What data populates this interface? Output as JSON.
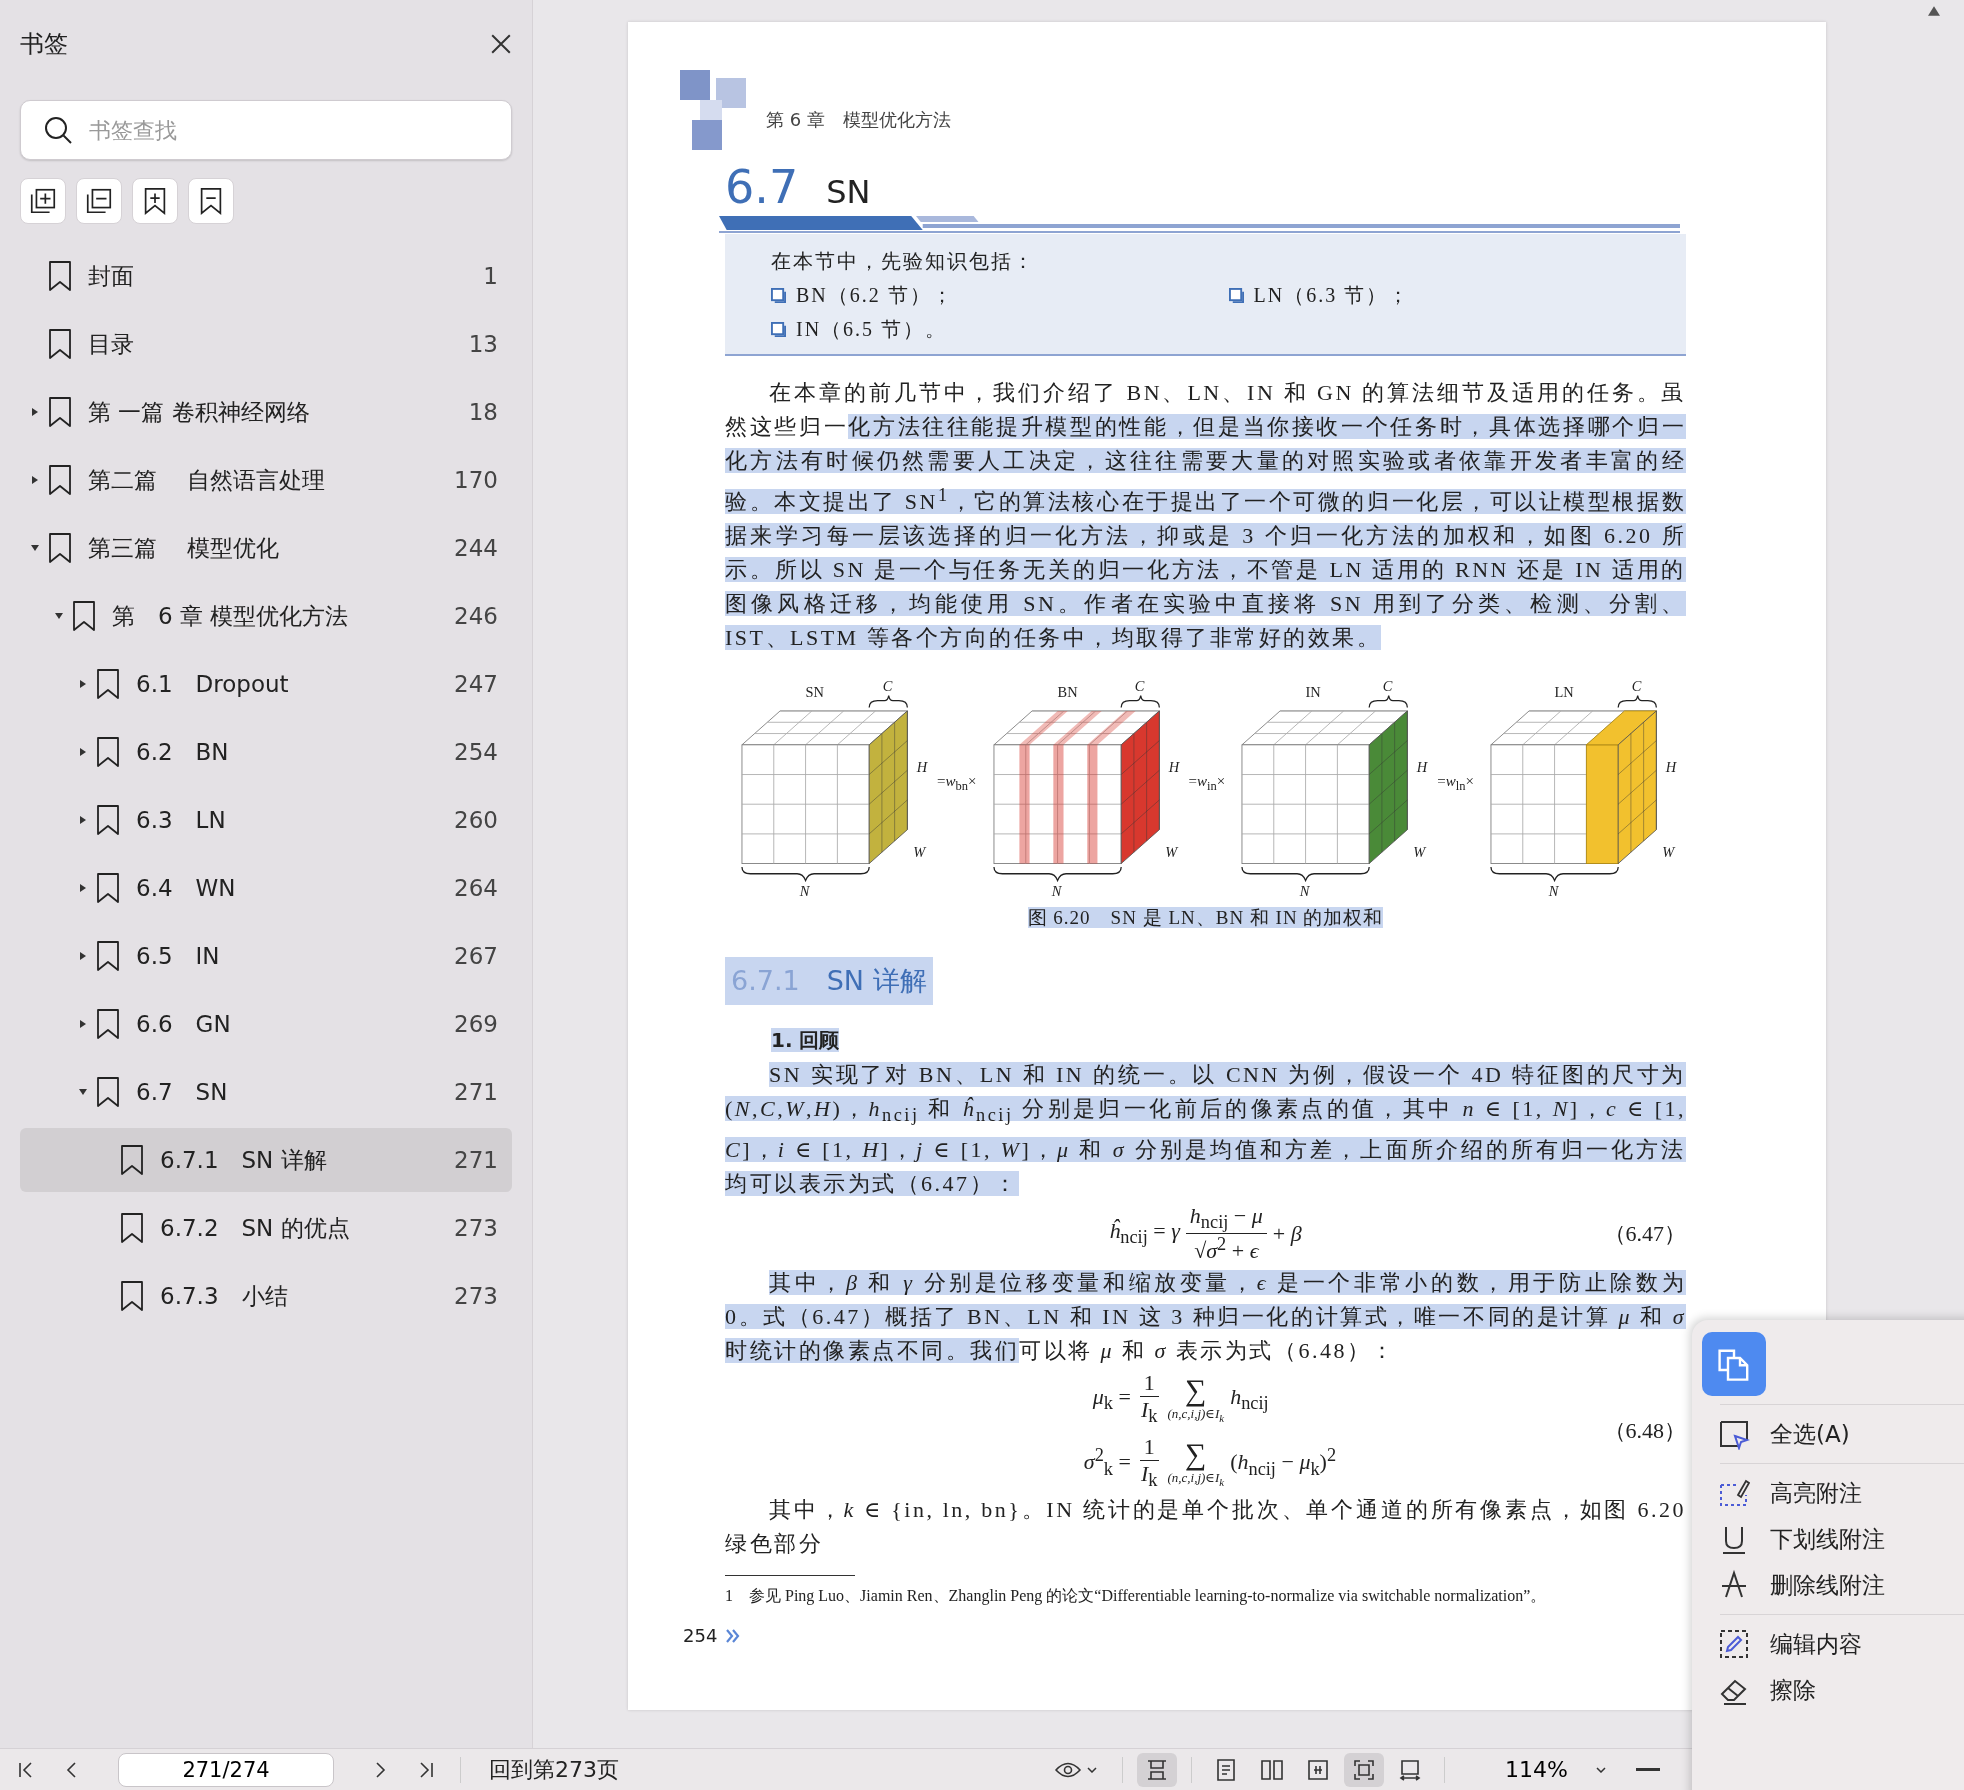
{
  "sidebar": {
    "title": "书签",
    "search": {
      "placeholder": "书签查找"
    },
    "items": [
      {
        "label": "封面",
        "page": "1",
        "selected": false
      },
      {
        "label": "目录",
        "page": "13",
        "selected": false
      },
      {
        "label": "第 一篇 卷积神经网络",
        "page": "18",
        "selected": false,
        "expanded": false
      },
      {
        "label": "第二篇　 自然语言处理",
        "page": "170",
        "selected": false,
        "expanded": false
      },
      {
        "label": "第三篇　 模型优化",
        "page": "244",
        "selected": false,
        "expanded": true,
        "children": [
          {
            "label": "第　6 章 模型优化方法",
            "page": "246",
            "selected": false,
            "expanded": true,
            "children": [
              {
                "label": "6.1　Dropout",
                "page": "247",
                "selected": false,
                "expanded": false
              },
              {
                "label": "6.2　BN",
                "page": "254",
                "selected": false,
                "expanded": false
              },
              {
                "label": "6.3　LN",
                "page": "260",
                "selected": false,
                "expanded": false
              },
              {
                "label": "6.4　WN",
                "page": "264",
                "selected": false,
                "expanded": false
              },
              {
                "label": "6.5　IN",
                "page": "267",
                "selected": false,
                "expanded": false
              },
              {
                "label": "6.6　GN",
                "page": "269",
                "selected": false,
                "expanded": false
              },
              {
                "label": "6.7　SN",
                "page": "271",
                "selected": false,
                "expanded": true,
                "children": [
                  {
                    "label": "6.7.1　SN 详解",
                    "page": "271",
                    "selected": true
                  },
                  {
                    "label": "6.7.2　SN 的优点",
                    "page": "273",
                    "selected": false
                  },
                  {
                    "label": "6.7.3　小结",
                    "page": "273",
                    "selected": false
                  }
                ]
              }
            ]
          }
        ]
      }
    ]
  },
  "page": {
    "running_head": "第 6 章　模型优化方法",
    "section_number": "6.7",
    "section_title": "SN",
    "prerequisites": {
      "title": "在本节中，先验知识包括：",
      "items": [
        "BN（6.2 节）；",
        "LN（6.3 节）；",
        "IN（6.5 节）。"
      ]
    },
    "blocks": [
      {
        "kind": "paragraph",
        "segments": [
          {
            "text": "在本章的前几节中，我们介绍了 BN、LN、IN 和 GN 的算法细节及适用的任务。虽然这些归一",
            "highlighted": false
          },
          {
            "text": "化方法往往能提升模型的性能，但是当你接收一个任务时，具体选择哪个归一化方法有时候仍然需要人工决定，这往往需要大量的对照实验或者依靠开发者丰富的经验。本文提出了 SN$^{1}$，它的算法核心在于提出了一个可微的归一化层，可以让模型根据数据来学习每一层该选择的归一化方法，抑或是 3 个归一化方法的加权和，如图 6.20 所示。所以 SN 是一个与任务无关的归一化方法，不管是 LN 适用的 RNN 还是 IN 适用的图像风格迁移，均能使用 SN。作者在实验中直接将 SN 用到了分类、检测、分割、IST、LSTM 等各个方向的任务中，均取得了非常好的效果。",
            "highlighted": true
          }
        ]
      },
      {
        "kind": "figure",
        "cubes": [
          {
            "label": "SN",
            "c": "C",
            "h": "H",
            "w": "W",
            "n": "N",
            "kind": "side",
            "color": "#c2b23e"
          },
          {
            "label": "BN",
            "c": "C",
            "h": "H",
            "w": "W",
            "n": "N",
            "kind": "stripes",
            "color": "#d8382e"
          },
          {
            "label": "IN",
            "c": "C",
            "h": "H",
            "w": "W",
            "n": "N",
            "kind": "side",
            "color": "#4a8a38"
          },
          {
            "label": "LN",
            "c": "C",
            "h": "H",
            "w": "W",
            "n": "N",
            "kind": "block",
            "color": "#f2c12e"
          }
        ],
        "operators": [
          "=*w*$_{bn}$×",
          "=*w*$_{in}$×",
          "=*w*$_{ln}$×"
        ]
      },
      {
        "kind": "caption",
        "text": "图 6.20　SN 是 LN、BN 和 IN 的加权和",
        "highlighted": true
      },
      {
        "kind": "heading",
        "number": "6.7.1",
        "text": "SN 详解",
        "highlighted": true
      },
      {
        "kind": "subheading",
        "text": "1.  回顾",
        "highlighted": true
      },
      {
        "kind": "paragraph",
        "segments": [
          {
            "text": "SN 实现了对 BN、LN 和 IN 的统一。以 CNN 为例，假设一个 4D 特征图的尺寸为 (*N*,*C*,*W*,*H*)，*h*$_{ncij}$ 和 *ĥ*$_{ncij}$ 分别是归一化前后的像素点的值，其中 *n* ∈ [1, *N*]，*c* ∈ [1, *C*]，*i* ∈ [1, *H*]，*j* ∈ [1, *W*]，*μ* 和 *σ* 分别是均值和方差，上面所介绍的所有归一化方法均可以表示为式（6.47）：",
            "highlighted": true
          }
        ]
      },
      {
        "kind": "formula",
        "lhs": "*ĥ*$_{ncij}$ = *γ*",
        "num": "*h*$_{ncij}$ − *μ*",
        "den": "√*σ*$^{2}$ + *ϵ*",
        "rhs": "+ *β*",
        "number": "（6.47）"
      },
      {
        "kind": "paragraph",
        "segments": [
          {
            "text": "其中，*β* 和 *γ* 分别是位移变量和缩放变量，*ϵ* 是一个非常小的数，用于防止除数为 0。式（6.47）概括了 BN、LN 和 IN 这 3 种归一化的计算式，唯一不同的是计算 *μ* 和 *σ* 时统计的像素点不同。我们",
            "highlighted": true
          },
          {
            "text": "可以将 *μ* 和 *σ* 表示为式（6.48）：",
            "highlighted": false
          }
        ]
      },
      {
        "kind": "formula_system",
        "rows": [
          {
            "lhs": "*μ*$_{k}$ =",
            "num": "1",
            "den": "*I*$_{k}$",
            "sum": "∑",
            "sub": "(*n*,*c*,*i*,*j*)∈*I*$_{k}$",
            "rhs": "*h*$_{ncij}$"
          },
          {
            "lhs": "*σ*$^{2}$$_{k}$ =",
            "num": "1",
            "den": "*I*$_{k}$",
            "sum": "∑",
            "sub": "(*n*,*c*,*i*,*j*)∈*I*$_{k}$",
            "rhs": "(*h*$_{ncij}$ − *μ*$_{k}$)$^{2}$"
          }
        ],
        "number": "（6.48）"
      },
      {
        "kind": "paragraph",
        "segments": [
          {
            "text": "其中，*k* ∈ {in, ln, bn}。IN 统计的是单个批次、单个通道的所有像素点，如图 6.20 绿色部分",
            "highlighted": false
          }
        ]
      },
      {
        "kind": "footnote",
        "mark": "1",
        "text": "参见 Ping Luo、Jiamin Ren、Zhanglin Peng 的论文“Differentiable learning-to-normalize via switchable normalization”。"
      }
    ],
    "folio": "254"
  },
  "bottom_bar": {
    "page_field": {
      "value": "271/274"
    },
    "back_link": "回到第273页",
    "view_buttons": [
      {
        "selected": true
      },
      {
        "selected": false
      },
      {
        "selected": false
      },
      {
        "selected": false
      },
      {
        "selected": true
      },
      {
        "selected": false
      }
    ],
    "zoom": {
      "value": "114%"
    }
  },
  "context_menu": {
    "groups": [
      [
        "全选(A)"
      ],
      [
        "高亮附注",
        "下划线附注",
        "删除线附注"
      ],
      [
        "编辑内容",
        "擦除"
      ]
    ]
  }
}
